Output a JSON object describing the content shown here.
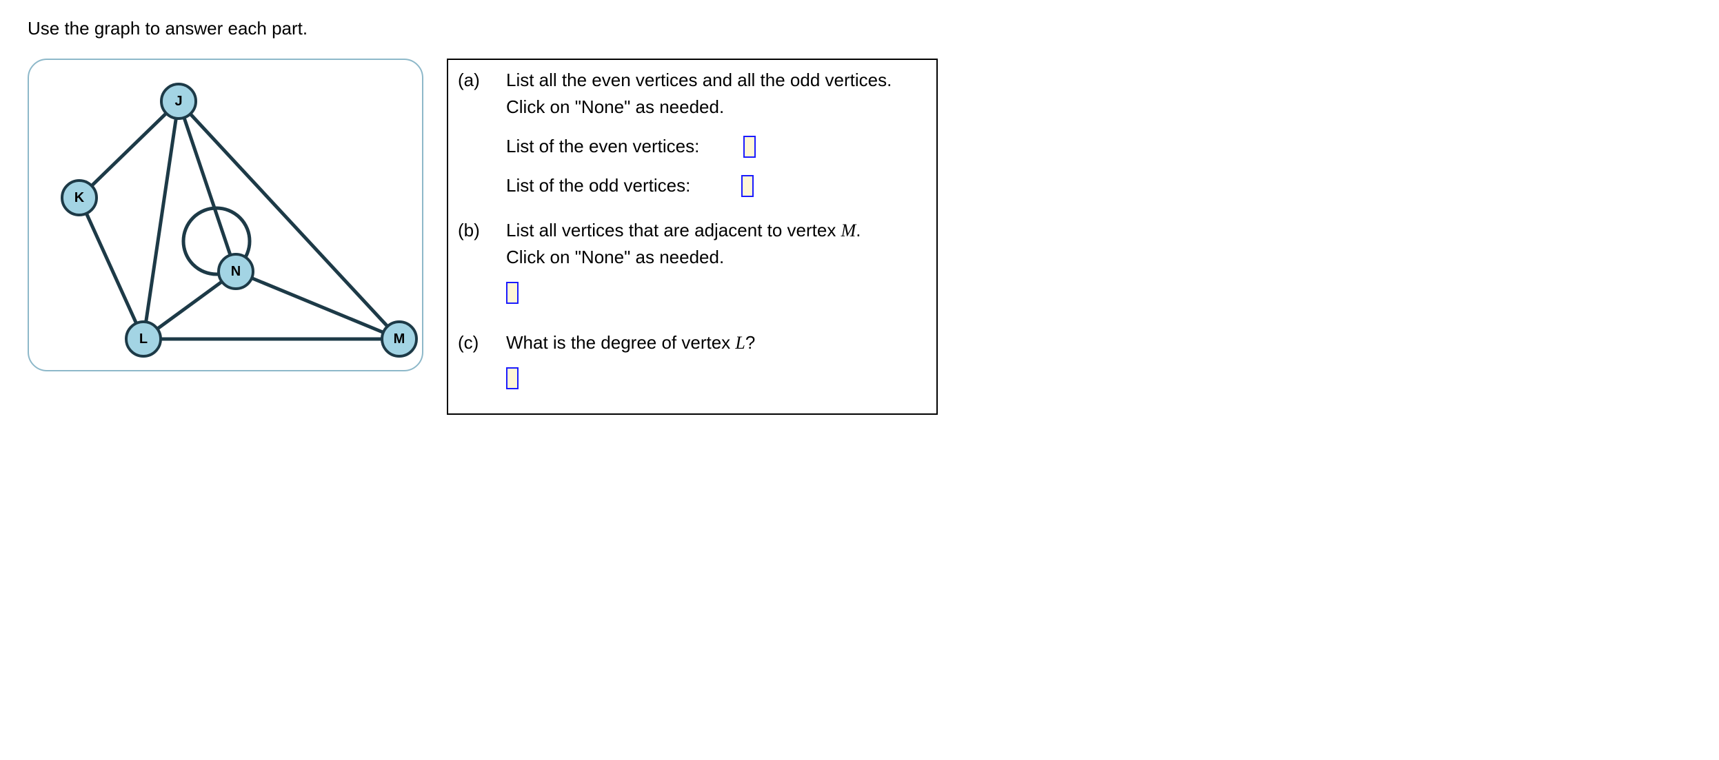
{
  "prompt": "Use the graph to answer each part.",
  "graph": {
    "vertices": {
      "J": "J",
      "K": "K",
      "L": "L",
      "M": "M",
      "N": "N"
    }
  },
  "questions": {
    "a": {
      "label": "(a)",
      "line1": "List all the even vertices and all the odd vertices.",
      "line2": "Click on \"None\" as needed.",
      "even_label": "List of the even vertices:",
      "odd_label": "List of the odd vertices:"
    },
    "b": {
      "label": "(b)",
      "line1_pre": "List all vertices that are adjacent to vertex ",
      "line1_var": "M",
      "line1_post": ".",
      "line2": "Click on \"None\" as needed."
    },
    "c": {
      "label": "(c)",
      "line1_pre": "What is the degree of vertex ",
      "line1_var": "L",
      "line1_post": "?"
    }
  }
}
